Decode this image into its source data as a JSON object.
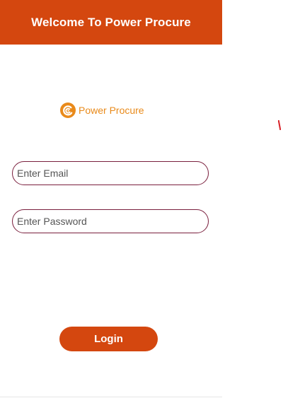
{
  "header": {
    "title": "Welcome To Power Procure"
  },
  "logo": {
    "text": "Power Procure",
    "icon": "power-procure-logo-icon"
  },
  "form": {
    "email_placeholder": "Enter Email",
    "password_placeholder": "Enter Password",
    "login_label": "Login"
  },
  "colors": {
    "brand": "#d4470f",
    "logo_orange": "#e98a1a",
    "field_border": "#7a1f3d",
    "mark_red": "#d8232a"
  }
}
